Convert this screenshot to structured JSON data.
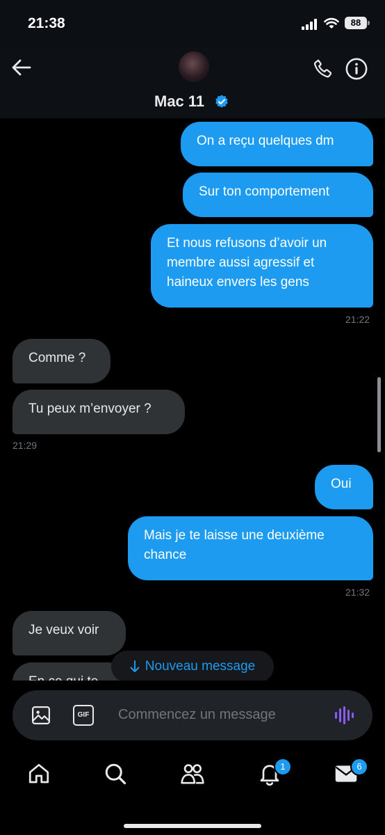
{
  "status_bar": {
    "time": "21:38",
    "battery": "88"
  },
  "header": {
    "contact_name": "Mac 11"
  },
  "messages": [
    {
      "text": "On a reçu quelques dm"
    },
    {
      "text": "Sur ton comportement"
    },
    {
      "text": "Et nous refusons d’avoir un membre aussi agressif et haineux envers les gens",
      "time": "21:22"
    },
    {
      "text": "Comme ?"
    },
    {
      "text": "Tu peux m’envoyer ?",
      "time": "21:29"
    },
    {
      "text": "Oui"
    },
    {
      "text": "Mais je te laisse une deuxième chance",
      "time": "21:32"
    },
    {
      "text": "Je veux voir"
    },
    {
      "text": "En ce qui te"
    }
  ],
  "new_message_pill": {
    "label": "Nouveau message"
  },
  "composer": {
    "placeholder": "Commencez un message",
    "gif_label": "GIF"
  },
  "tab_bar": {
    "notifications_badge": "1",
    "messages_badge": "6"
  },
  "colors": {
    "accent": "#1d9bf0",
    "incoming_bubble": "#2f3336",
    "background": "#000000",
    "voice_icon": "#8a5cf6"
  }
}
